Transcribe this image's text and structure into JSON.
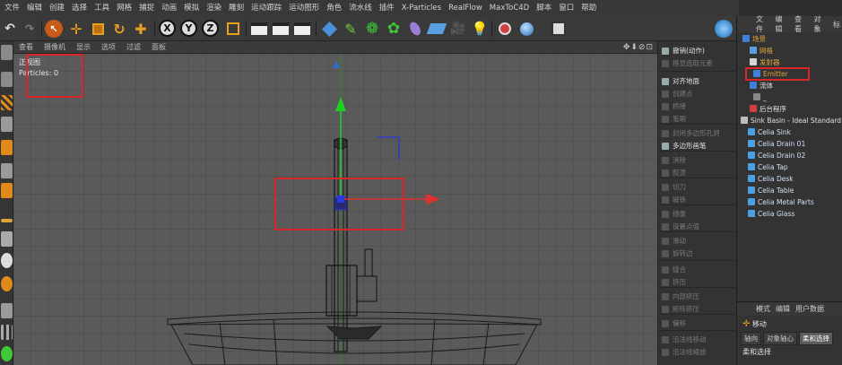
{
  "menubar": [
    "文件",
    "编辑",
    "创建",
    "选择",
    "工具",
    "网格",
    "捕捉",
    "动画",
    "模拟",
    "渲染",
    "雕刻",
    "运动跟踪",
    "运动图形",
    "角色",
    "流水线",
    "插件",
    "X-Particles",
    "RealFlow",
    "MaxToC4D",
    "脚本",
    "窗口",
    "帮助"
  ],
  "viewport": {
    "menu": [
      "查看",
      "摄像机",
      "显示",
      "选项",
      "过滤",
      "面板"
    ],
    "nav_icons": "✥⬇⊘⊡",
    "label": "正视图",
    "particles": "Particles: 0"
  },
  "commands": [
    {
      "label": "撤销(动作)",
      "on": true
    },
    {
      "label": "框显选取元素",
      "on": false
    },
    {
      "label": "对齐地面",
      "on": true
    },
    {
      "label": "创建点",
      "on": false
    },
    {
      "label": "桥接",
      "on": false
    },
    {
      "label": "笔刷",
      "on": false
    },
    {
      "label": "封闭多边形孔洞",
      "on": false
    },
    {
      "label": "多边形画笔",
      "on": true
    },
    {
      "label": "消除",
      "on": false
    },
    {
      "label": "熨烫",
      "on": false
    },
    {
      "label": "切刀",
      "on": false
    },
    {
      "label": "磁铁",
      "on": false
    },
    {
      "label": "镜像",
      "on": false
    },
    {
      "label": "设置点值",
      "on": false
    },
    {
      "label": "滑动",
      "on": false
    },
    {
      "label": "旋转边",
      "on": false
    },
    {
      "label": "缝合",
      "on": false
    },
    {
      "label": "挤压",
      "on": false
    },
    {
      "label": "内部挤压",
      "on": false
    },
    {
      "label": "矩阵挤压",
      "on": false
    },
    {
      "label": "偏移",
      "on": false
    },
    {
      "label": "沿法线移动",
      "on": false
    },
    {
      "label": "沿法线缩放",
      "on": false
    }
  ],
  "object_manager": {
    "menu": [
      "文件",
      "编辑",
      "查看",
      "对象",
      "标"
    ],
    "tree": [
      {
        "label": "场景",
        "color": "#e0a53a",
        "icon": "#3f7fd6"
      },
      {
        "label": "网格",
        "color": "#e0a53a",
        "icon": "#5aa0e0"
      },
      {
        "label": "发射器",
        "color": "#e0a53a",
        "icon": "#d6d6d6"
      },
      {
        "label": "Emitter",
        "color": "#e0a53a",
        "icon": "#3f7fd6"
      },
      {
        "label": "流体",
        "color": "#e0e0e0",
        "icon": "#3f7fd6"
      },
      {
        "label": "_",
        "color": "#e0e0e0",
        "icon": "#888"
      },
      {
        "label": "后台程序",
        "color": "#e0e0e0",
        "icon": "#d04040"
      },
      {
        "label": "Sink Basin - Ideal Standard",
        "color": "#e0e0e0",
        "icon": "#bdbdbd"
      },
      {
        "label": "Celia Sink",
        "color": "#cfe0f5",
        "icon": "#4aa0e0"
      },
      {
        "label": "Celia Drain 01",
        "color": "#cfe0f5",
        "icon": "#4aa0e0"
      },
      {
        "label": "Celia Drain  02",
        "color": "#cfe0f5",
        "icon": "#4aa0e0"
      },
      {
        "label": "Celia Tap",
        "color": "#cfe0f5",
        "icon": "#4aa0e0"
      },
      {
        "label": "Celia Desk",
        "color": "#cfe0f5",
        "icon": "#4aa0e0"
      },
      {
        "label": "Celia Table",
        "color": "#cfe0f5",
        "icon": "#4aa0e0"
      },
      {
        "label": "Celia Metal Parts",
        "color": "#cfe0f5",
        "icon": "#4aa0e0"
      },
      {
        "label": "Celia Glass",
        "color": "#cfe0f5",
        "icon": "#4aa0e0"
      }
    ]
  },
  "attributes": {
    "menu": [
      "模式",
      "编辑",
      "用户数据"
    ],
    "title": "移动",
    "tabs": [
      "轴向",
      "对象轴心",
      "柔和选择"
    ],
    "active_tab": "柔和选择",
    "section": "柔和选择"
  },
  "colors": {
    "highlight": "#d9262b",
    "axis_y": "#1fd11f",
    "axis_x": "#e03030",
    "grid": "#4a4a4a"
  }
}
